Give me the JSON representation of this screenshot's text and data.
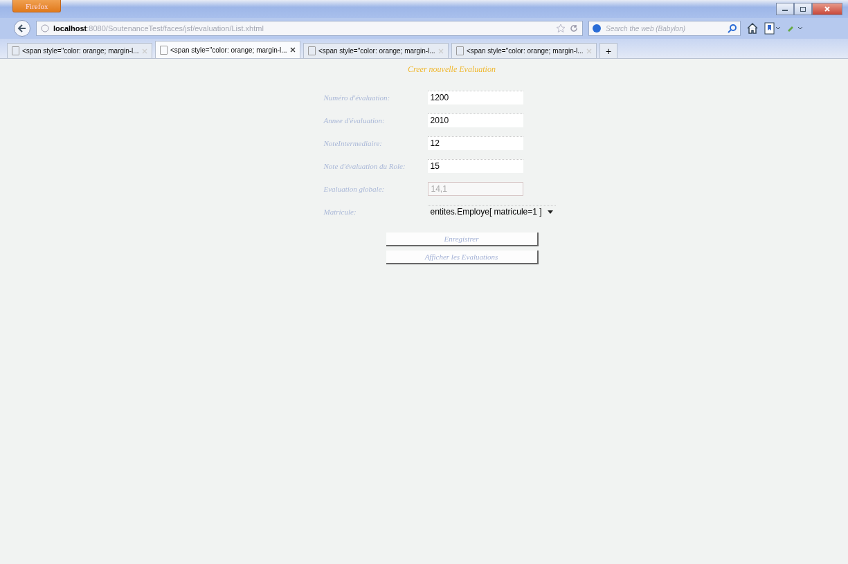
{
  "browser": {
    "menu_button": "Firefox",
    "url_host": "localhost",
    "url_path": ":8080/SoutenanceTest/faces/jsf/evaluation/List.xhtml",
    "search": {
      "placeholder": "Search the web (Babylon)"
    }
  },
  "tabs": [
    {
      "label": "<span style=\"color: orange; margin-l...",
      "selected": false
    },
    {
      "label": "<span style=\"color: orange; margin-l...",
      "selected": true
    },
    {
      "label": "<span style=\"color: orange; margin-l...",
      "selected": false
    },
    {
      "label": "<span style=\"color: orange; margin-l...",
      "selected": false
    }
  ],
  "new_tab": "+",
  "form": {
    "title": "Creer nouvelle Evaluation",
    "fields": [
      {
        "label": "Numéro d'évaluation:",
        "kind": "text",
        "value": "1200",
        "disabled": false
      },
      {
        "label": "Annee d'évaluation:",
        "kind": "text",
        "value": "2010",
        "disabled": false
      },
      {
        "label": "NoteIntermediaire:",
        "kind": "text",
        "value": "12",
        "disabled": false
      },
      {
        "label": "Note d'évaluation du Role:",
        "kind": "text",
        "value": "15",
        "disabled": false
      },
      {
        "label": "Evaluation globale:",
        "kind": "text",
        "value": "14,1",
        "disabled": true
      },
      {
        "label": "Matricule:",
        "kind": "select",
        "value": "entites.Employe[ matricule=1 ]",
        "disabled": false
      }
    ],
    "buttons": [
      "Enregistrer",
      "Afficher les Evaluations"
    ]
  }
}
